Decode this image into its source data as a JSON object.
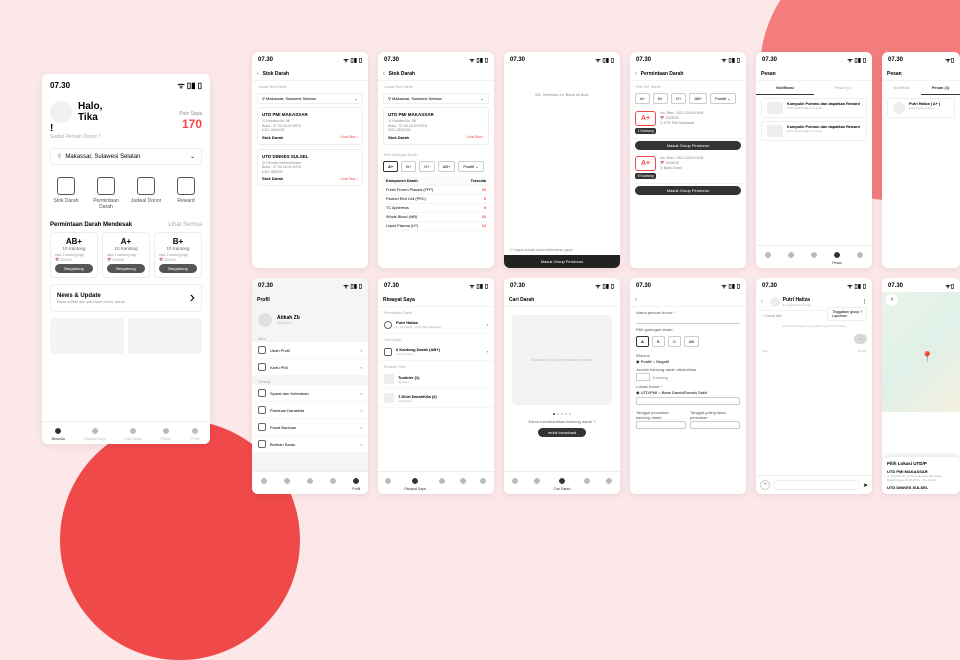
{
  "status": {
    "time": "07.30",
    "signal": "▮▮▯",
    "wifi": "⌃",
    "batt": "▮"
  },
  "home": {
    "greeting": "Halo, Tika !",
    "greeting_sub": "Sudah Pernah Donor ?",
    "points_label": "Poin Saya",
    "points": "170",
    "location": "Makassar, Sulawesi Selatan",
    "menu": [
      "Stok Darah",
      "Permintaan Darah",
      "Jadwal Donor",
      "Reward"
    ],
    "urgent_title": "Permintaan Darah Mendesak",
    "see_all": "Lihat Semua",
    "cards": [
      {
        "type": "AB+",
        "qty": "10 Kantong",
        "rem": "sisa 2 kantong lagi",
        "date": "22/5/20",
        "btn": "Bergabung"
      },
      {
        "type": "A+",
        "qty": "10 Kantong",
        "rem": "sisa 2 kantong lagi",
        "date": "22/5/20",
        "btn": "Bergabung"
      },
      {
        "type": "B+",
        "qty": "10 Kantong",
        "rem": "sisa 2 kantong lagi",
        "date": "22/5/20",
        "btn": "Bergabung"
      }
    ],
    "news_title": "News & Update",
    "news_sub": "Baca artikel dan panduan donor darah",
    "nav": [
      "Beranda",
      "Riwayat Saya",
      "Cari Darah",
      "Pesan",
      "Profil"
    ]
  },
  "stok": {
    "title": "Stok Darah",
    "loc_label": "Lokasi Stok Darah",
    "location": "Makassar, Sulawesi Selatan",
    "utd": [
      {
        "name": "UTD PMI MAKASSAR",
        "addr1": "Jl. Kandea No. 58",
        "addr2": "Buka : 07.00-16.00 WITA",
        "addr3": "0411-3624318",
        "stok_lbl": "Stok Darah",
        "link": "Lihat Stok ›"
      },
      {
        "name": "UTD DINKES SULSEL",
        "addr1": "Jl. Perintis Kemerdekaan",
        "addr2": "Buka : 07.00-16.00 WITA",
        "addr3": "0411-582678",
        "stok_lbl": "Stok Darah",
        "link": "Lihat Stok ›"
      }
    ],
    "gol_label": "Pilih Golongan Darah",
    "gol": [
      "A+",
      "B+",
      "O+",
      "AB+"
    ],
    "rhesus": "Positif",
    "table_head": [
      "Komponen Darah",
      "Tersedia"
    ],
    "table": [
      {
        "k": "Fresh Frozen Plasma (FFP)",
        "v": "10"
      },
      {
        "k": "Packed Red Cell (PRC)",
        "v": "5"
      },
      {
        "k": "TC Apheresis",
        "v": "9"
      },
      {
        "k": "Whole Blood (WB)",
        "v": "10"
      },
      {
        "k": "Liquid Plasma (LP)",
        "v": "12"
      }
    ]
  },
  "consent": {
    "text": "IDL Sebelum ini, Baca ini dulu",
    "check": "saya sudah baca ketentuan grup",
    "btn": "Masuk Group Pendonor"
  },
  "req": {
    "title": "Permintaan Darah",
    "lbl": "Pilih Gol. Darah",
    "gol": [
      "A+",
      "B+",
      "O+",
      "AB+"
    ],
    "rhesus": "Positif",
    "items": [
      {
        "type": "A+",
        "qty": "1 Kantong",
        "no": "No. Resi : UD0-22015-0199",
        "date": "22/05/20",
        "loc": "UTD PMI Makassar",
        "btn": "Masuk Group Pendonor"
      },
      {
        "type": "A+",
        "qty": "5 Kantong",
        "no": "No. Resi : UD0-22015-0199",
        "date": "22/05/20",
        "loc": "Bank Darah",
        "btn": "Masuk Group Pendonor"
      }
    ]
  },
  "pesan": {
    "title": "Pesan",
    "tabs": [
      "Notifikasi",
      "Pesan (1)"
    ],
    "notifs": [
      {
        "t": "Kumpulin Poinmu dan dapatkan Reward",
        "s": "lorem ipsum dolor sit amet"
      },
      {
        "t": "Kumpulin Poinmu dan dapatkan Reward",
        "s": "lorem ipsum dolor sit amet"
      }
    ],
    "chat": {
      "name": "Putri Haliza ( A+ )",
      "sub": "Lorem ipsum dolor..."
    }
  },
  "profil": {
    "title": "Profil",
    "name": "Atikah Zb",
    "dob": "18.10.19",
    "sec_akun": "Akun",
    "akun": [
      "Ubah Profil",
      "Kartu PMI"
    ],
    "sec_tentang": "Tentang",
    "tentang": [
      "Syarat dan Ketentuan",
      "Panduan Darahkita",
      "Pusat Bantuan",
      "Berikan Saran"
    ]
  },
  "riwayat": {
    "title": "Riwayat Saya",
    "sec1": "Permintaan Darah",
    "item1": {
      "name": "Putri Haliza",
      "date": "1 - Apr 2020",
      "loc": "UTD PMI Makassar"
    },
    "sec2": "Cari Darah",
    "item2": {
      "name": "6 Kantong Darah (AB+)",
      "sub": "Lorem ipsum"
    },
    "sec3": "Redeam Poin",
    "poin": [
      {
        "name": "Tumbler (1)",
        "sub": "diproses"
      },
      {
        "name": "T-Shirt DarahKita (2)",
        "sub": "Lihat Resi"
      }
    ]
  },
  "cari": {
    "title": "Cari Darah",
    "ph_text": "Broadcast Grup dan temukan pendonor",
    "q": "Kamu membutuhkan kantong darah ?",
    "btn": "mulai broadcast"
  },
  "form": {
    "f1": "Nama pencari donor",
    "f2": "Pilih golongan darah",
    "gol": [
      "A",
      "B",
      "O",
      "AB"
    ],
    "f3": "Rhesus",
    "rh": [
      "Positif",
      "Negatif"
    ],
    "f4": "Jumlah kantong darah dibutuhkan",
    "unit": "Kantong",
    "f5": "Lokasi Donor",
    "opts": [
      "UTD/PMI",
      "Bank Darah/Rumah Sakit"
    ],
    "f6": "Tanggal pencarian kantong darah",
    "f7": "Tanggal paling lama pencarian"
  },
  "chat": {
    "name": "Putri Haliza",
    "sub": "5 Anggota Grup Lagi!",
    "menu": [
      "Tinggalkan group ?",
      "Laporkan"
    ],
    "info": "Group Info",
    "sys": "Atikah Zb bergabung ke dalam grup Putri Haliza"
  },
  "maps": {
    "title": "Pilih Lokasi UTD/P",
    "items": [
      {
        "name": "UTD PMI MAKASSAR",
        "addr": "Jl. Kandea No. 8 Bontoala Kec. Bontoala",
        "info": "Buka hingga 16.00 WITA · No. Telp 0…"
      },
      {
        "name": "UTD DINKES SULSEL"
      }
    ]
  }
}
